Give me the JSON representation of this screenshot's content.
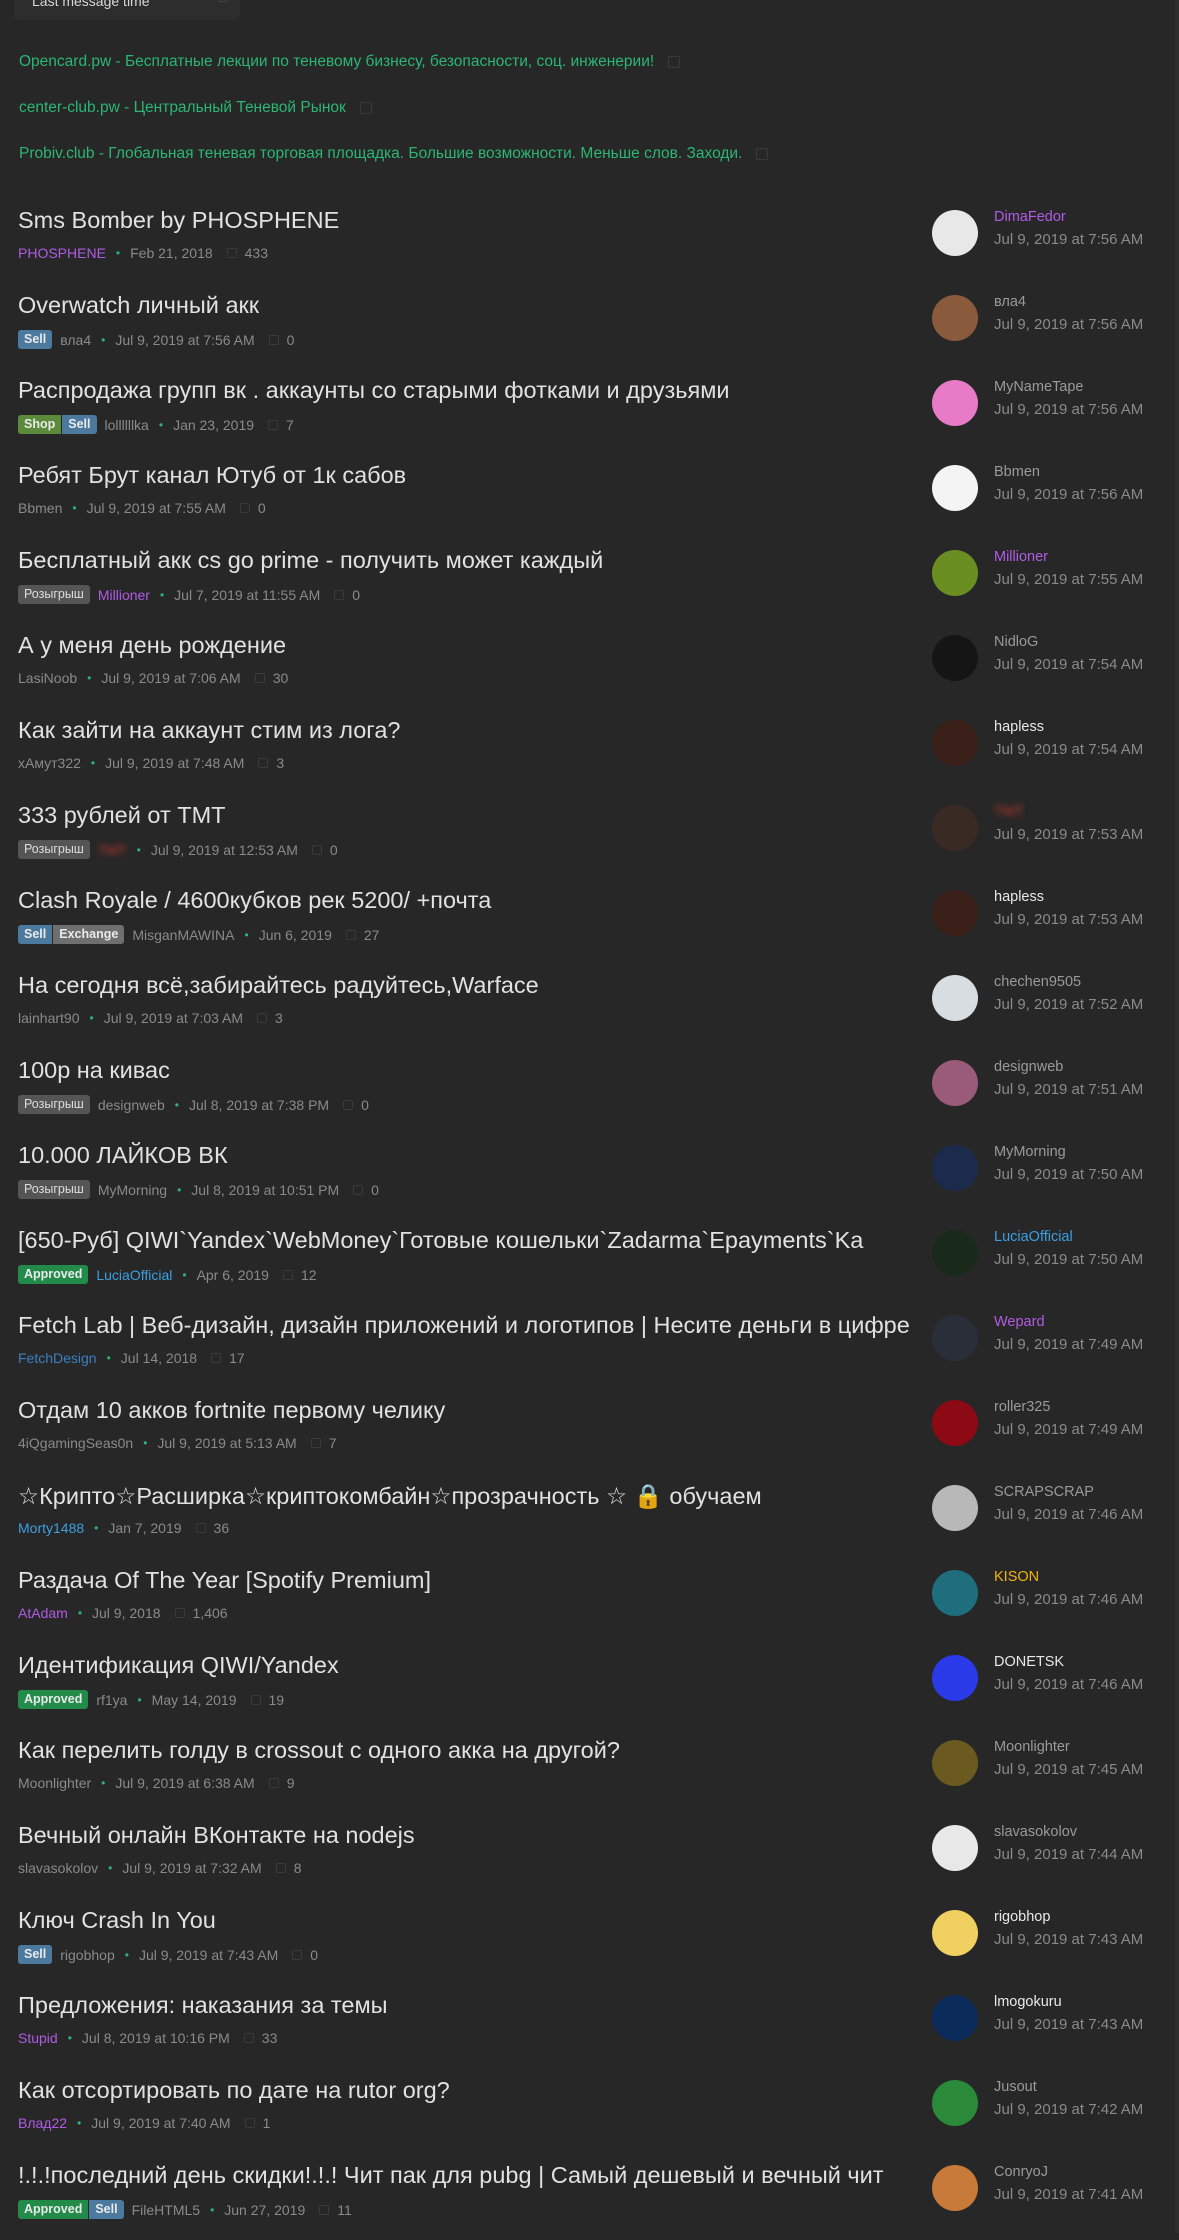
{
  "sort": {
    "label": "Last message time"
  },
  "ads": [
    "Opencard.pw - Бесплатные лекции по теневому бизнесу, безопасности, соц. инженерии!",
    "center-club.pw - Центральный Теневой Рынок",
    "Probiv.club - Глобальная теневая торговая площадка. Большие возможности. Меньше слов. Заходи."
  ],
  "colors": {
    "ad": "#2bb673",
    "purple": "#b05be6",
    "blue": "#3b9fe0",
    "gold": "#f0b50c",
    "white": "#e8e8e8"
  },
  "threads": [
    {
      "title": "Sms Bomber by PHOSPHENE",
      "tags": [],
      "author": "PHOSPHENE",
      "author_color": "#b05be6",
      "date": "Feb 21, 2018",
      "replies": "433",
      "last_user": "DimaFedor",
      "last_color": "#b05be6",
      "last_date": "Jul 9, 2019 at 7:56 AM",
      "avatar": "#e8e8e8"
    },
    {
      "title": "Overwatch личный акк",
      "tags": [
        "Sell"
      ],
      "author": "вла4",
      "author_color": "#8a8a8a",
      "date": "Jul 9, 2019 at 7:56 AM",
      "replies": "0",
      "last_user": "вла4",
      "last_color": "#9a9a9a",
      "last_date": "Jul 9, 2019 at 7:56 AM",
      "avatar": "#8a5a3c"
    },
    {
      "title": "Распродажа групп вк . аккаунты со старыми фотками и друзьями",
      "tags": [
        "Shop",
        "Sell"
      ],
      "author": "lollllllka",
      "author_color": "#8a8a8a",
      "date": "Jan 23, 2019",
      "replies": "7",
      "last_user": "MyNameTape",
      "last_color": "#9a9a9a",
      "last_date": "Jul 9, 2019 at 7:56 AM",
      "avatar": "#e77bc8"
    },
    {
      "title": "Ребят Брут канал Ютуб от 1к сабов",
      "tags": [],
      "author": "Bbmen",
      "author_color": "#8a8a8a",
      "date": "Jul 9, 2019 at 7:55 AM",
      "replies": "0",
      "last_user": "Bbmen",
      "last_color": "#9a9a9a",
      "last_date": "Jul 9, 2019 at 7:56 AM",
      "avatar": "#f4f4f4"
    },
    {
      "title": "Бесплатный акк cs go prime - получить может каждый",
      "tags": [
        "Розыгрыш"
      ],
      "author": "Millioner",
      "author_color": "#b05be6",
      "date": "Jul 7, 2019 at 11:55 AM",
      "replies": "0",
      "last_user": "Millioner",
      "last_color": "#b05be6",
      "last_date": "Jul 9, 2019 at 7:55 AM",
      "avatar": "#6b8e23"
    },
    {
      "title": "А у меня день рождение",
      "tags": [],
      "author": "LasiNoob",
      "author_color": "#8a8a8a",
      "date": "Jul 9, 2019 at 7:06 AM",
      "replies": "30",
      "last_user": "NidloG",
      "last_color": "#9a9a9a",
      "last_date": "Jul 9, 2019 at 7:54 AM",
      "avatar": "#151515"
    },
    {
      "title": "Как зайти на аккаунт стим из лога?",
      "tags": [],
      "author": "хАмут322",
      "author_color": "#8a8a8a",
      "date": "Jul 9, 2019 at 7:48 AM",
      "replies": "3",
      "last_user": "hapless",
      "last_color": "#e8e8e8",
      "last_date": "Jul 9, 2019 at 7:54 AM",
      "avatar": "#3a1e18"
    },
    {
      "title": "333 рублей от TMT",
      "tags": [
        "Розыгрыш"
      ],
      "author": "TMT",
      "author_color": "#c0392b",
      "date": "Jul 9, 2019 at 12:53 AM",
      "replies": "0",
      "last_user": "TMT",
      "last_color": "#c0392b",
      "last_date": "Jul 9, 2019 at 7:53 AM",
      "avatar": "#3a2a24",
      "blur": true
    },
    {
      "title": "Clash Royale / 4600кубков рек 5200/ +почта",
      "tags": [
        "Sell",
        "Exchange"
      ],
      "author": "MisganMAWINA",
      "author_color": "#8a8a8a",
      "date": "Jun 6, 2019",
      "replies": "27",
      "last_user": "hapless",
      "last_color": "#e8e8e8",
      "last_date": "Jul 9, 2019 at 7:53 AM",
      "avatar": "#3a1e18"
    },
    {
      "title": "На сегодня всё,забирайтесь радуйтесь,Warface",
      "tags": [],
      "author": "lainhart90",
      "author_color": "#8a8a8a",
      "date": "Jul 9, 2019 at 7:03 AM",
      "replies": "3",
      "last_user": "chechen9505",
      "last_color": "#9a9a9a",
      "last_date": "Jul 9, 2019 at 7:52 AM",
      "avatar": "#d8dde2"
    },
    {
      "title": "100р на кивас",
      "tags": [
        "Розыгрыш"
      ],
      "author": "designweb",
      "author_color": "#8a8a8a",
      "date": "Jul 8, 2019 at 7:38 PM",
      "replies": "0",
      "last_user": "designweb",
      "last_color": "#9a9a9a",
      "last_date": "Jul 9, 2019 at 7:51 AM",
      "avatar": "#9a5a7a"
    },
    {
      "title": "10.000 ЛАЙКОВ ВК",
      "tags": [
        "Розыгрыш"
      ],
      "author": "MyMorning",
      "author_color": "#8a8a8a",
      "date": "Jul 8, 2019 at 10:51 PM",
      "replies": "0",
      "last_user": "MyMorning",
      "last_color": "#9a9a9a",
      "last_date": "Jul 9, 2019 at 7:50 AM",
      "avatar": "#1c2a4e"
    },
    {
      "title": "[650-Руб] QIWI`Yandex`WebMoney`Готовые кошельки`Zadarma`Epayments`Ka",
      "tags": [
        "Approved"
      ],
      "author": "LuciaOfficial",
      "author_color": "#3b9fe0",
      "date": "Apr 6, 2019",
      "replies": "12",
      "last_user": "LuciaOfficial",
      "last_color": "#3b9fe0",
      "last_date": "Jul 9, 2019 at 7:50 AM",
      "avatar": "#1a2a1a"
    },
    {
      "title": "Fetch Lab | Веб-дизайн, дизайн приложений и логотипов | Несите деньги в цифре",
      "tags": [],
      "author": "FetchDesign",
      "author_color": "#3b7fc0",
      "date": "Jul 14, 2018",
      "replies": "17",
      "last_user": "Wepard",
      "last_color": "#b05be6",
      "last_date": "Jul 9, 2019 at 7:49 AM",
      "avatar": "#2a2e38"
    },
    {
      "title": "Отдам 10 акков fortnite первому челику",
      "tags": [],
      "author": "4iQgamingSeas0n",
      "author_color": "#8a8a8a",
      "date": "Jul 9, 2019 at 5:13 AM",
      "replies": "7",
      "last_user": "roller325",
      "last_color": "#9a9a9a",
      "last_date": "Jul 9, 2019 at 7:49 AM",
      "avatar": "#8b0a14"
    },
    {
      "title": "☆Крипто☆Расширка☆криптокомбайн☆прозрачность ☆ 🔒 обучаем",
      "tags": [],
      "author": "Morty1488",
      "author_color": "#3b9fe0",
      "date": "Jan 7, 2019",
      "replies": "36",
      "last_user": "SCRAPSCRAP",
      "last_color": "#9a9a9a",
      "last_date": "Jul 9, 2019 at 7:46 AM",
      "avatar": "#b8b8b8"
    },
    {
      "title": "Раздача Of The Year [Spotify Premium]",
      "tags": [],
      "author": "AtAdam",
      "author_color": "#b05be6",
      "date": "Jul 9, 2018",
      "replies": "1,406",
      "last_user": "KISON",
      "last_color": "#f0b50c",
      "last_date": "Jul 9, 2019 at 7:46 AM",
      "avatar": "#1e6e7e"
    },
    {
      "title": "Идентификация QIWI/Yandex",
      "tags": [
        "Approved"
      ],
      "author": "rf1ya",
      "author_color": "#8a8a8a",
      "date": "May 14, 2019",
      "replies": "19",
      "last_user": "DONETSK",
      "last_color": "#e8e8e8",
      "last_date": "Jul 9, 2019 at 7:46 AM",
      "avatar": "#2a3ae8"
    },
    {
      "title": "Как перелить голду в crossout с одного акка на другой?",
      "tags": [],
      "author": "Moonlighter",
      "author_color": "#8a8a8a",
      "date": "Jul 9, 2019 at 6:38 AM",
      "replies": "9",
      "last_user": "Moonlighter",
      "last_color": "#9a9a9a",
      "last_date": "Jul 9, 2019 at 7:45 AM",
      "avatar": "#6a5a20"
    },
    {
      "title": "Вечный онлайн ВКонтакте на nodejs",
      "tags": [],
      "author": "slavasokolov",
      "author_color": "#8a8a8a",
      "date": "Jul 9, 2019 at 7:32 AM",
      "replies": "8",
      "last_user": "slavasokolov",
      "last_color": "#9a9a9a",
      "last_date": "Jul 9, 2019 at 7:44 AM",
      "avatar": "#e8e8e8"
    },
    {
      "title": "Ключ Crash In You",
      "tags": [
        "Sell"
      ],
      "author": "rigobhop",
      "author_color": "#8a8a8a",
      "date": "Jul 9, 2019 at 7:43 AM",
      "replies": "0",
      "last_user": "rigobhop",
      "last_color": "#e8e8e8",
      "last_date": "Jul 9, 2019 at 7:43 AM",
      "avatar": "#f0d060"
    },
    {
      "title": "Предложения: наказания за темы",
      "tags": [],
      "author": "Stupid",
      "author_color": "#b05be6",
      "date": "Jul 8, 2019 at 10:16 PM",
      "replies": "33",
      "last_user": "lmogokuru",
      "last_color": "#e8e8e8",
      "last_date": "Jul 9, 2019 at 7:43 AM",
      "avatar": "#0a2a5a"
    },
    {
      "title": "Как отсортировать по дате на rutor org?",
      "tags": [],
      "author": "Влад22",
      "author_color": "#b05be6",
      "date": "Jul 9, 2019 at 7:40 AM",
      "replies": "1",
      "last_user": "Jusout",
      "last_color": "#9a9a9a",
      "last_date": "Jul 9, 2019 at 7:42 AM",
      "avatar": "#2a8a3a"
    },
    {
      "title": "!.!.!последний день скидки!.!.! Чит пак для pubg | Самый дешевый и вечный чит",
      "tags": [
        "Approved",
        "Sell"
      ],
      "author": "FileHTML5",
      "author_color": "#8a8a8a",
      "date": "Jun 27, 2019",
      "replies": "11",
      "last_user": "ConryoJ",
      "last_color": "#9a9a9a",
      "last_date": "Jul 9, 2019 at 7:41 AM",
      "avatar": "#c87a3a"
    }
  ]
}
